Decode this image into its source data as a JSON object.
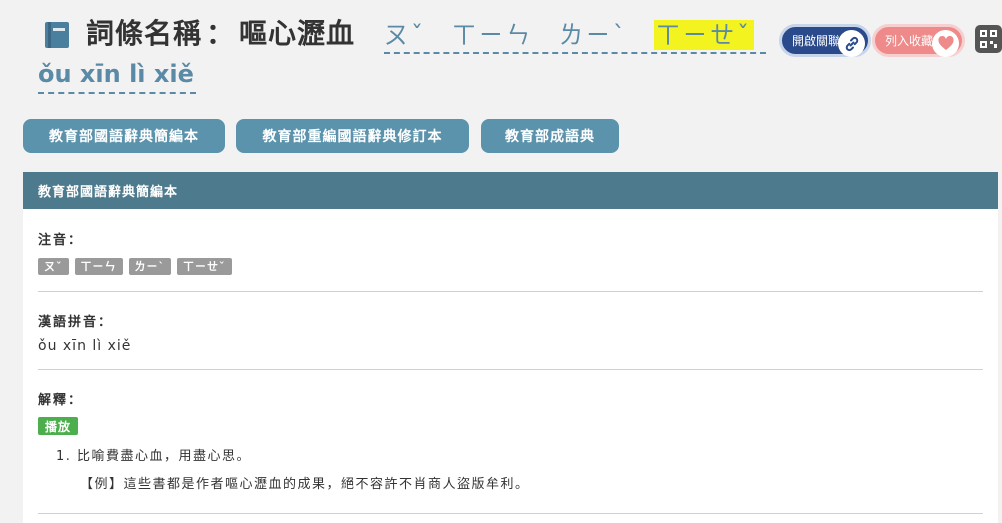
{
  "header": {
    "title_prefix": "詞條名稱",
    "title_sep": "：",
    "title_word": "嘔心瀝血",
    "zhuyin": [
      "ㄡˇ",
      "ㄒㄧㄣ",
      "ㄌㄧˋ",
      "ㄒㄧㄝˇ"
    ],
    "pinyin": "ǒu xīn lì xiě",
    "link_button_label": "開啟關聯",
    "fav_button_label": "列入收藏",
    "icons": {
      "book": "book-icon",
      "link": "link-icon",
      "heart": "heart-icon",
      "qr": "qr-code-icon"
    }
  },
  "tabs": [
    "教育部國語辭典簡編本",
    "教育部重編國語辭典修訂本",
    "教育部成語典"
  ],
  "panel": {
    "heading": "教育部國語辭典簡編本",
    "zhuyin_label": "注音：",
    "zhuyin_chips": [
      "ㄡˇ",
      "ㄒㄧㄣ",
      "ㄌㄧˋ",
      "ㄒㄧㄝˇ"
    ],
    "pinyin_label": "漢語拼音：",
    "pinyin_value": "ǒu xīn lì xiě",
    "definition_label": "解釋：",
    "play_label": "播放",
    "definition": "1. 比喻費盡心血，用盡心思。",
    "example": "【例】這些書都是作者嘔心瀝血的成果，絕不容許不肖商人盜版牟利。"
  },
  "colors": {
    "accent": "#5b8aa6",
    "tab_button": "#5b93ad",
    "panel_head": "#4d7a8c",
    "link_pill": "#2a4a8c",
    "fav_pill": "#ef8a8a",
    "play_button": "#4cae4c",
    "highlight": "#f3f31f"
  }
}
